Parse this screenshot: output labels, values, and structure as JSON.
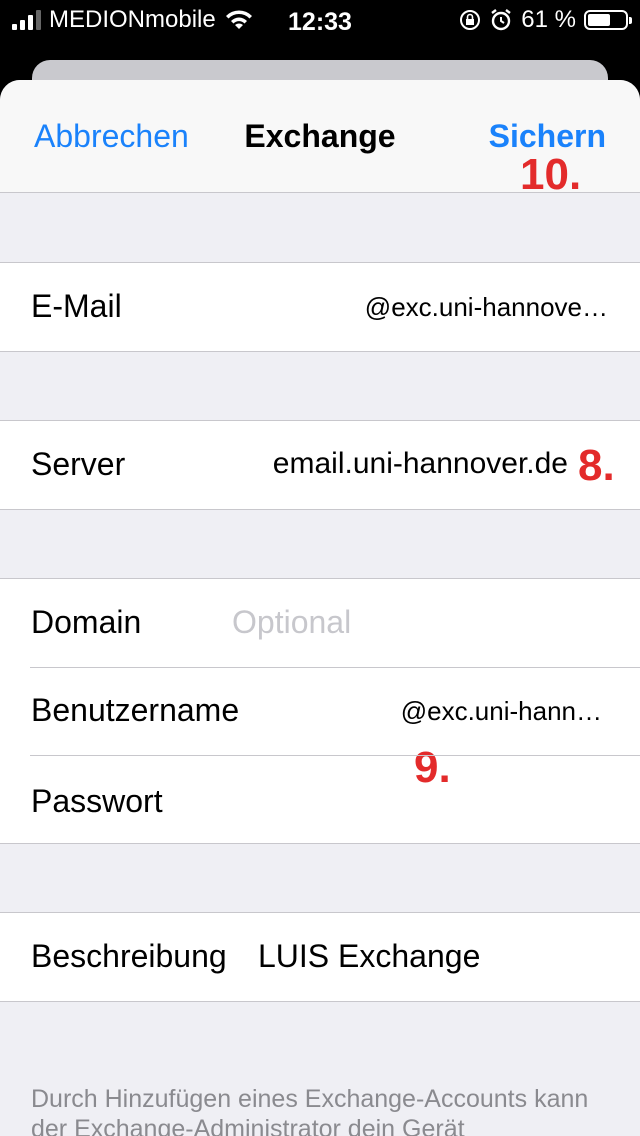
{
  "status": {
    "carrier": "MEDIONmobile",
    "time": "12:33",
    "battery_percent": "61 %",
    "battery_level": 0.61
  },
  "nav": {
    "cancel_label": "Abbrechen",
    "title": "Exchange",
    "save_label": "Sichern"
  },
  "annotations": {
    "save": "10.",
    "server": "8.",
    "credentials": "9."
  },
  "form": {
    "email": {
      "label": "E-Mail",
      "value": "@exc.uni-hannove…"
    },
    "server": {
      "label": "Server",
      "value": "email.uni-hannover.de"
    },
    "domain": {
      "label": "Domain",
      "placeholder": "Optional"
    },
    "username": {
      "label": "Benutzername",
      "value": "@exc.uni-hann…"
    },
    "password": {
      "label": "Passwort",
      "value": ""
    },
    "description": {
      "label": "Beschreibung",
      "value": "LUIS Exchange"
    }
  },
  "footer_text": "Durch Hinzufügen eines Exchange-Accounts kann der Exchange-Administrator dein Gerät"
}
